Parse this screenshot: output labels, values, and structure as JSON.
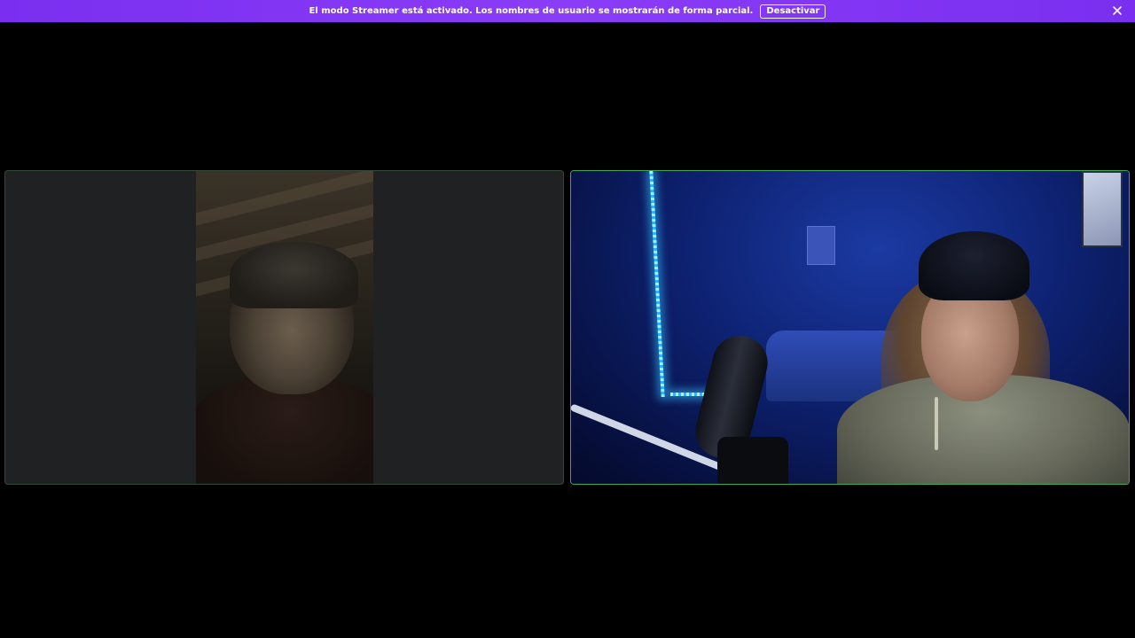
{
  "banner": {
    "message": "El modo Streamer está activado. Los nombres de usuario se mostrarán de forma parcial.",
    "button_label": "Desactivar",
    "background_color": "#7b2ff2",
    "close_icon": "close-icon"
  },
  "call": {
    "participants": [
      {
        "tile": "left",
        "speaking": false,
        "border_color": "#34493a"
      },
      {
        "tile": "right",
        "speaking": true,
        "border_color": "#3fa65a"
      }
    ]
  }
}
